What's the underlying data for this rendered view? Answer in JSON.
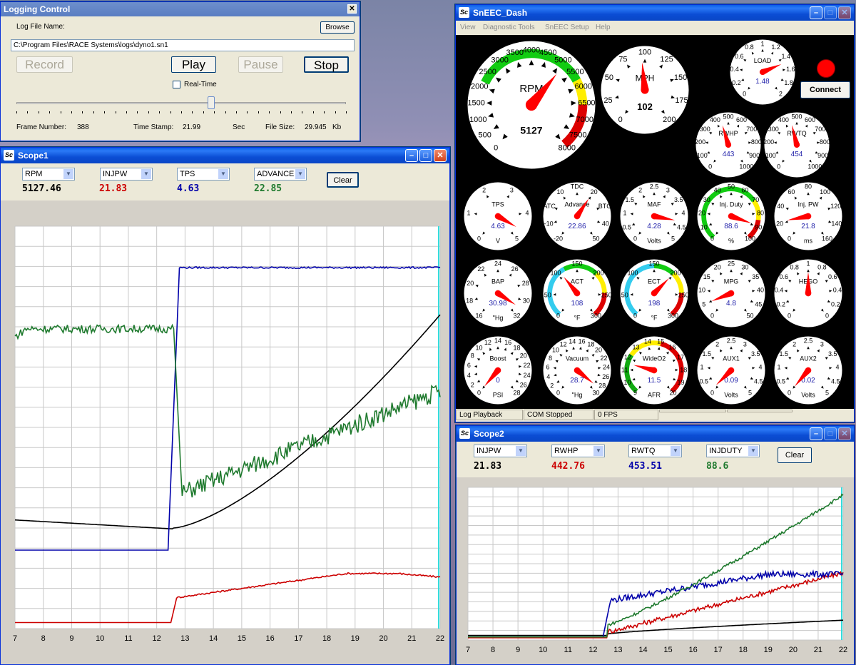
{
  "logging": {
    "title": "Logging Control",
    "file_label": "Log File Name:",
    "browse": "Browse",
    "file_path": "C:\\Program Files\\RACE Systems\\logs\\dyno1.sn1",
    "record": "Record",
    "play": "Play",
    "pause": "Pause",
    "stop": "Stop",
    "realtime": "Real-Time",
    "slider_position": 0.59,
    "frame_label": "Frame Number:",
    "frame": "388",
    "timestamp_label": "Time Stamp:",
    "timestamp": "21.99",
    "sec": "Sec",
    "size_label": "File Size:",
    "size": "29.945",
    "kb": "Kb"
  },
  "dash": {
    "title": "SnEEC_Dash",
    "menus": [
      "View",
      "Diagnostic Tools",
      "SnEEC Setup",
      "Help"
    ],
    "connect": "Connect",
    "status": [
      "Log Playback",
      "COM Stopped",
      "0 FPS",
      "",
      ""
    ],
    "gauges": [
      {
        "id": "rpm",
        "title": "RPM",
        "value": "5127",
        "frac": 0.64,
        "ticks": [
          "0",
          "500",
          "1000",
          "1500",
          "2000",
          "2500",
          "3000",
          "3500",
          "4000",
          "4500",
          "5000",
          "5500",
          "6000",
          "6500",
          "7000",
          "7500",
          "8000"
        ]
      },
      {
        "id": "mph",
        "title": "MPH",
        "value": "102",
        "frac": 0.48,
        "ticks": [
          "0",
          "25",
          "50",
          "75",
          "100",
          "125",
          "150",
          "175",
          "200"
        ]
      },
      {
        "id": "load",
        "title": "LOAD",
        "value": "1.48",
        "frac": 0.74,
        "ticks": [
          "0",
          "0.2",
          "0.4",
          "0.6",
          "0.8",
          "1",
          "1.2",
          "1.4",
          "1.6",
          "1.8",
          "2"
        ]
      },
      {
        "id": "rwhp",
        "title": "RWHP",
        "value": "443",
        "frac": 0.44,
        "ticks": [
          "0",
          "100",
          "200",
          "300",
          "400",
          "500",
          "600",
          "700",
          "800",
          "900",
          "1000"
        ]
      },
      {
        "id": "rwtq",
        "title": "RWTQ",
        "value": "454",
        "frac": 0.45,
        "ticks": [
          "0",
          "100",
          "200",
          "300",
          "400",
          "500",
          "600",
          "700",
          "800",
          "900",
          "1000"
        ]
      },
      {
        "id": "tps",
        "title": "TPS",
        "value": "4.63",
        "unit": "V",
        "frac": 0.93,
        "ticks": [
          "0",
          "1",
          "2",
          "3",
          "4",
          "5"
        ]
      },
      {
        "id": "adv",
        "title": "Advance",
        "value": "22.86",
        "frac": 0.62,
        "ticks": [
          "-20",
          "-10",
          "ATC",
          "10",
          "TDC",
          "20",
          "BTC",
          "40",
          "50"
        ]
      },
      {
        "id": "maf",
        "title": "MAF",
        "value": "4.28",
        "unit": "Volts",
        "frac": 0.86,
        "ticks": [
          "0",
          "0.5",
          "1",
          "1.5",
          "2",
          "2.5",
          "3",
          "3.5",
          "4",
          "4.5",
          "5"
        ]
      },
      {
        "id": "injduty",
        "title": "Inj. Duty",
        "value": "88.6",
        "unit": "%",
        "frac": 0.89,
        "ticks": [
          "0",
          "10",
          "20",
          "30",
          "40",
          "50",
          "60",
          "70",
          "80",
          "90",
          "100"
        ]
      },
      {
        "id": "injpw",
        "title": "Inj. PW",
        "value": "21.8",
        "unit": "ms",
        "frac": 0.14,
        "ticks": [
          "0",
          "20",
          "40",
          "60",
          "80",
          "100",
          "120",
          "140",
          "160"
        ]
      },
      {
        "id": "bap",
        "title": "BAP",
        "value": "30.98",
        "unit": "\"Hg",
        "frac": 0.94,
        "ticks": [
          "16",
          "18",
          "20",
          "22",
          "24",
          "26",
          "28",
          "30",
          "32"
        ]
      },
      {
        "id": "act",
        "title": "ACT",
        "value": "108",
        "unit": "°F",
        "frac": 0.36,
        "ticks": [
          "0",
          "50",
          "100",
          "150",
          "200",
          "250",
          "300"
        ]
      },
      {
        "id": "ect",
        "title": "ECT",
        "value": "198",
        "unit": "°F",
        "frac": 0.66,
        "ticks": [
          "0",
          "50",
          "100",
          "150",
          "200",
          "250",
          "300"
        ]
      },
      {
        "id": "mpg",
        "title": "MPG",
        "value": "4.8",
        "frac": 0.1,
        "ticks": [
          "0",
          "5",
          "10",
          "15",
          "20",
          "25",
          "30",
          "35",
          "40",
          "45",
          "50"
        ]
      },
      {
        "id": "hego",
        "title": "HEGO",
        "value": "",
        "frac": 0.5,
        "ticks": [
          "0",
          "0.2",
          "0.4",
          "0.6",
          "0.8",
          "1",
          "0.8",
          "0.6",
          "0.4",
          "0.2",
          "0"
        ]
      },
      {
        "id": "boost",
        "title": "Boost",
        "value": "0",
        "unit": "PSI",
        "frac": 0.0,
        "ticks": [
          "0",
          "2",
          "4",
          "6",
          "8",
          "10",
          "12",
          "14",
          "16",
          "18",
          "20",
          "22",
          "24",
          "26",
          "28"
        ]
      },
      {
        "id": "vacuum",
        "title": "Vacuum",
        "value": "28.7",
        "unit": "\"Hg",
        "frac": 0.96,
        "ticks": [
          "0",
          "2",
          "4",
          "6",
          "8",
          "10",
          "12",
          "14",
          "16",
          "18",
          "20",
          "22",
          "24",
          "26",
          "28",
          "30"
        ]
      },
      {
        "id": "wideo2",
        "title": "WideO2",
        "value": "11.5",
        "unit": "AFR",
        "frac": 0.23,
        "ticks": [
          "9",
          "10",
          "11",
          "12",
          "13",
          "14",
          "15",
          "16",
          "17",
          "18",
          "19",
          "20"
        ]
      },
      {
        "id": "aux1",
        "title": "AUX1",
        "value": "0.09",
        "unit": "Volts",
        "frac": 0.02,
        "ticks": [
          "0",
          "0.5",
          "1",
          "1.5",
          "2",
          "2.5",
          "3",
          "3.5",
          "4",
          "4.5",
          "5"
        ]
      },
      {
        "id": "aux2",
        "title": "AUX2",
        "value": "0.02",
        "unit": "Volts",
        "frac": 0.0,
        "ticks": [
          "0",
          "0.5",
          "1",
          "1.5",
          "2",
          "2.5",
          "3",
          "3.5",
          "4",
          "4.5",
          "5"
        ]
      }
    ]
  },
  "scope1": {
    "title": "Scope1",
    "clear": "Clear",
    "channels": [
      {
        "name": "RPM",
        "value": "5127.46",
        "color": "#000000"
      },
      {
        "name": "INJPW",
        "value": "21.83",
        "color": "#cc0000"
      },
      {
        "name": "TPS",
        "value": "4.63",
        "color": "#0000aa"
      },
      {
        "name": "ADVANCE",
        "value": "22.85",
        "color": "#1f7a2e"
      }
    ],
    "xticks": [
      "7",
      "8",
      "9",
      "10",
      "11",
      "12",
      "13",
      "14",
      "15",
      "16",
      "17",
      "18",
      "19",
      "20",
      "21",
      "22"
    ]
  },
  "scope2": {
    "title": "Scope2",
    "clear": "Clear",
    "channels": [
      {
        "name": "INJPW",
        "value": "21.83",
        "color": "#000000"
      },
      {
        "name": "RWHP",
        "value": "442.76",
        "color": "#cc0000"
      },
      {
        "name": "RWTQ",
        "value": "453.51",
        "color": "#0000aa"
      },
      {
        "name": "INJDUTY",
        "value": "88.6",
        "color": "#1f7a2e"
      }
    ],
    "xticks": [
      "7",
      "8",
      "9",
      "10",
      "11",
      "12",
      "13",
      "14",
      "15",
      "16",
      "17",
      "18",
      "19",
      "20",
      "21",
      "22"
    ]
  }
}
